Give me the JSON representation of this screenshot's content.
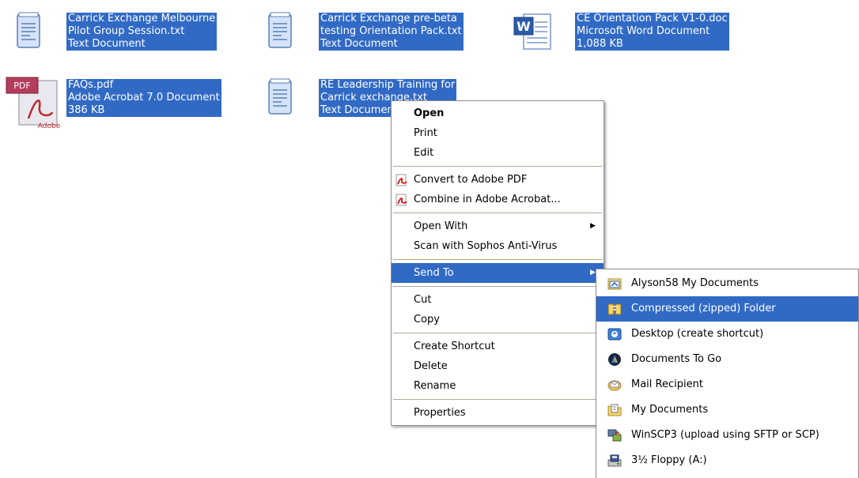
{
  "files": [
    {
      "lines": [
        "Carrick Exchange Melbourne",
        "Pilot Group Session.txt",
        "Text Document"
      ],
      "icon": "text-document-icon"
    },
    {
      "lines": [
        "Carrick Exchange pre-beta",
        "testing Orientation Pack.txt",
        "Text Document"
      ],
      "icon": "text-document-icon"
    },
    {
      "lines": [
        "CE Orientation Pack V1-0.doc",
        "Microsoft Word Document",
        "1,088 KB"
      ],
      "icon": "word-document-icon"
    },
    {
      "lines": [
        "FAQs.pdf",
        "Adobe Acrobat 7.0 Document",
        "386 KB"
      ],
      "icon": "pdf-document-icon",
      "badge": "PDF",
      "brand": "Adobe"
    },
    {
      "lines": [
        "RE Leadership Training for",
        "Carrick exchange.txt",
        "Text Document"
      ],
      "icon": "text-document-icon"
    }
  ],
  "context_menu": {
    "open": "Open",
    "print": "Print",
    "edit": "Edit",
    "convert_pdf": "Convert to Adobe PDF",
    "combine_acrobat": "Combine in Adobe Acrobat...",
    "open_with": "Open With",
    "scan": "Scan with Sophos Anti-Virus",
    "send_to": "Send To",
    "cut": "Cut",
    "copy": "Copy",
    "create_shortcut": "Create Shortcut",
    "delete": "Delete",
    "rename": "Rename",
    "properties": "Properties"
  },
  "send_to_menu": {
    "items": [
      "Alyson58 My Documents",
      "Compressed (zipped) Folder",
      "Desktop (create shortcut)",
      "Documents To Go",
      "Mail Recipient",
      "My Documents",
      "WinSCP3 (upload using SFTP or SCP)",
      "3½ Floppy (A:)"
    ],
    "selected_index": 1
  },
  "colors": {
    "selection": "#316ac5",
    "menu_border": "#8d8d8d",
    "separator": "#aca899"
  }
}
